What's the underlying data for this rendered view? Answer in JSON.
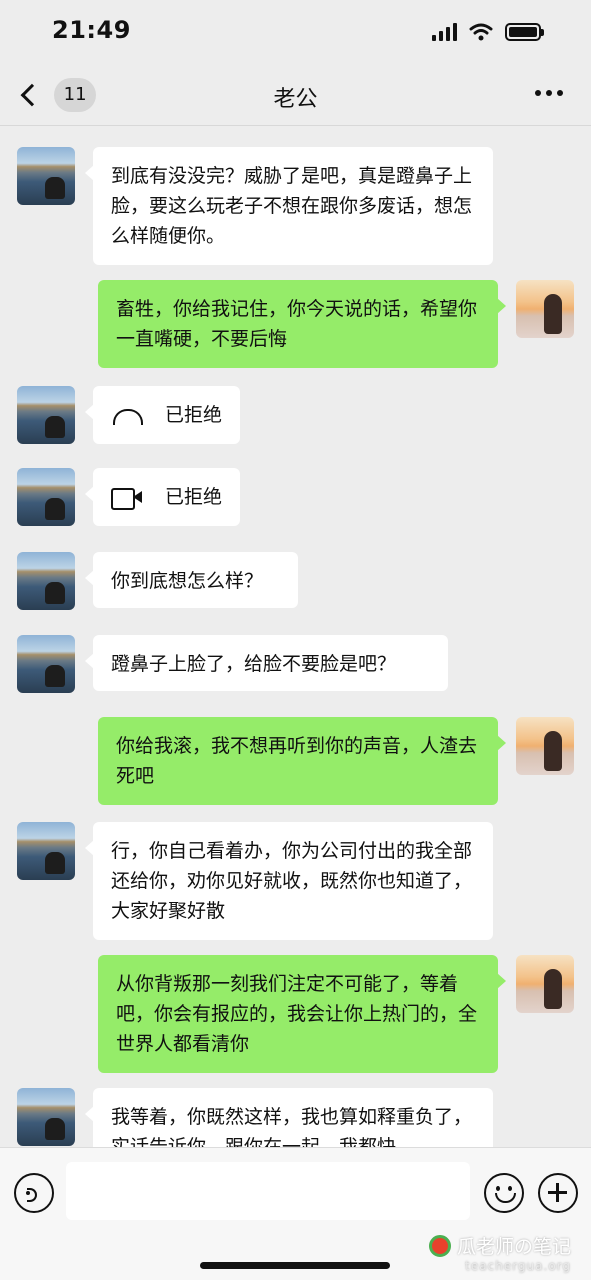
{
  "status_bar": {
    "time": "21:49"
  },
  "header": {
    "back_badge": "11",
    "title": "老公"
  },
  "messages": [
    {
      "side": "left",
      "type": "text",
      "text": "到底有没没完？威胁了是吧，真是蹬鼻子上脸，要这么玩老子不想在跟你多废话，想怎么样随便你。"
    },
    {
      "side": "right",
      "type": "text",
      "text": "畜牲，你给我记住，你今天说的话，希望你一直嘴硬，不要后悔"
    },
    {
      "side": "left",
      "type": "voice-call",
      "icon": "phone-icon",
      "text": "已拒绝"
    },
    {
      "side": "left",
      "type": "video-call",
      "icon": "video-camera-icon",
      "text": "已拒绝"
    },
    {
      "side": "left",
      "type": "text",
      "text": "你到底想怎么样？"
    },
    {
      "side": "left",
      "type": "text",
      "text": "蹬鼻子上脸了，给脸不要脸是吧？"
    },
    {
      "side": "right",
      "type": "text",
      "text": "你给我滚，我不想再听到你的声音，人渣去死吧"
    },
    {
      "side": "left",
      "type": "text",
      "text": "行，你自己看着办，你为公司付出的我全部还给你，劝你见好就收，既然你也知道了，大家好聚好散"
    },
    {
      "side": "right",
      "type": "text",
      "text": "从你背叛那一刻我们注定不可能了，等着吧，你会有报应的，我会让你上热门的，全世界人都看清你"
    },
    {
      "side": "left",
      "type": "text",
      "text": "我等着，你既然这样，我也算如释重负了，实话告诉你，跟你在一起，我都快"
    }
  ],
  "input_bar": {
    "placeholder": ""
  },
  "watermark": {
    "title": "瓜老师の笔记",
    "url": "teachergua.org"
  },
  "colors": {
    "background": "#ededed",
    "bubble_right": "#95ec69",
    "bubble_left": "#ffffff"
  }
}
